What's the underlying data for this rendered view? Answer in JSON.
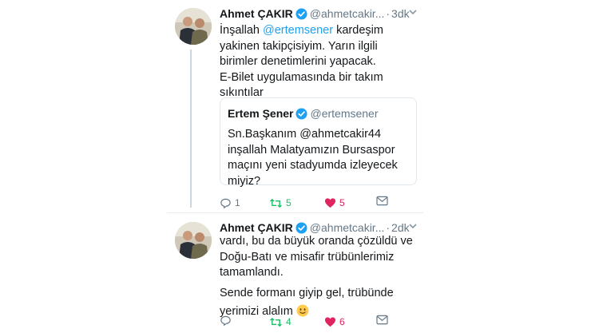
{
  "tweets": [
    {
      "author_name": "Ahmet ÇAKIR",
      "author_handle": "@ahmetcakir...",
      "dot": "·",
      "time": "3dk",
      "text": {
        "l1a": "İnşallah ",
        "l1m": "@ertemsener",
        "l1b": " kardeşim",
        "l2": "yakinen takipçisiyim. Yarın ilgili",
        "l3": "birimler denetimlerini yapacak.",
        "l4": "E-Bilet uygulamasında bir takım",
        "l5": "sıkıntılar"
      },
      "quote": {
        "author_name": "Ertem Şener",
        "author_handle": "@ertemsener",
        "l1": "Sn.Başkanım @ahmetcakir44",
        "l2": "inşallah Malatyamızın Bursaspor",
        "l3": "maçını yeni stadyumda izleyecek",
        "l4": "miyiz?"
      },
      "replies": "1",
      "retweets": "5",
      "likes": "5"
    },
    {
      "author_name": "Ahmet ÇAKIR",
      "author_handle": "@ahmetcakir...",
      "dot": "·",
      "time": "2dk",
      "text": {
        "l1": "vardı, bu da büyük oranda çözüldü ve",
        "l2": "Doğu-Batı ve misafir trübünlerimiz",
        "l3": "tamamlandı.",
        "l4": "Sende formanı giyip gel, trübünde",
        "l5": "yerimizi alalım"
      },
      "replies": "",
      "retweets": "4",
      "likes": "6"
    }
  ],
  "colors": {
    "link": "#1da1f2",
    "retweet": "#17bf63",
    "like": "#e0245e",
    "muted": "#657786"
  },
  "icons": [
    "verified-badge-icon",
    "chevron-down-icon",
    "reply-icon",
    "retweet-icon",
    "heart-icon",
    "direct-message-icon",
    "smiling-face-emoji"
  ]
}
